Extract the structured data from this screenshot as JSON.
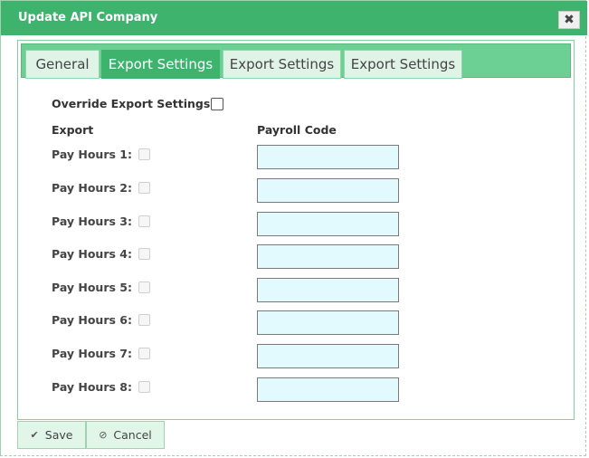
{
  "dialog": {
    "title": "Update API Company",
    "close_icon": "close-icon"
  },
  "tabs": [
    {
      "label": "General",
      "active": false
    },
    {
      "label": "Export Settings",
      "active": true
    },
    {
      "label": "Export Settings",
      "active": false
    },
    {
      "label": "Export Settings",
      "active": false
    }
  ],
  "form": {
    "override_label": "Override Export Settings:",
    "override_checked": false,
    "export_header": "Export",
    "payroll_header": "Payroll Code",
    "rows": [
      {
        "label": "Pay Hours 1:",
        "checked": false,
        "payroll_code": ""
      },
      {
        "label": "Pay Hours 2:",
        "checked": false,
        "payroll_code": ""
      },
      {
        "label": "Pay Hours 3:",
        "checked": false,
        "payroll_code": ""
      },
      {
        "label": "Pay Hours 4:",
        "checked": false,
        "payroll_code": ""
      },
      {
        "label": "Pay Hours 5:",
        "checked": false,
        "payroll_code": ""
      },
      {
        "label": "Pay Hours 6:",
        "checked": false,
        "payroll_code": ""
      },
      {
        "label": "Pay Hours 7:",
        "checked": false,
        "payroll_code": ""
      },
      {
        "label": "Pay Hours 8:",
        "checked": false,
        "payroll_code": ""
      }
    ]
  },
  "footer": {
    "save_label": "Save",
    "save_icon": "check-icon",
    "cancel_label": "Cancel",
    "cancel_icon": "cancel-icon"
  },
  "colors": {
    "accent": "#3eb36e",
    "tab_strip": "#6ccf94",
    "input_bg": "#e2fafd"
  }
}
